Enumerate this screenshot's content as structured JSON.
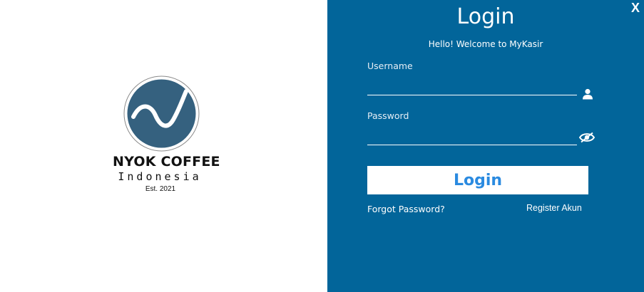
{
  "brand": {
    "name": "NYOK COFFEE",
    "subtitle": "Indonesia",
    "established": "Est. 2021",
    "logo_color": "#35617f"
  },
  "login": {
    "title": "Login",
    "welcome": "Hello! Welcome to MyKasir",
    "close_label": "X",
    "username": {
      "label": "Username",
      "value": "",
      "placeholder": "",
      "icon": "user-icon"
    },
    "password": {
      "label": "Password",
      "value": "",
      "placeholder": "",
      "icon": "eye-icon"
    },
    "submit_label": "Login",
    "forgot_label": "Forgot Password?",
    "register_label": "Register Akun"
  },
  "colors": {
    "panel_bg": "#02659a",
    "button_text": "#2a8ae0",
    "button_bg": "#ffffff"
  }
}
